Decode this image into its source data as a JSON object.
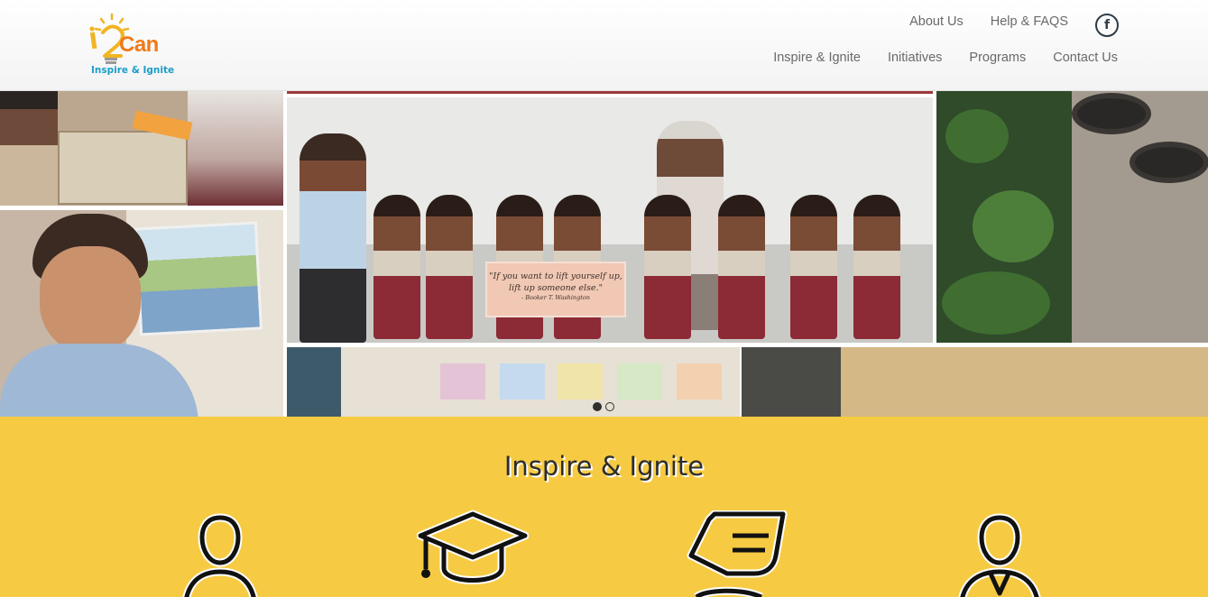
{
  "logo": {
    "brand": "Can",
    "tagline": "Inspire & Ignite",
    "colors": {
      "word": "#ef7a1a",
      "tagline": "#1b9ec9",
      "bulb": "#f2b422"
    }
  },
  "top_nav": {
    "links": [
      {
        "label": "About Us"
      },
      {
        "label": "Help & FAQS"
      }
    ],
    "facebook_icon": "facebook-icon"
  },
  "main_nav": {
    "items": [
      {
        "label": "Inspire & Ignite"
      },
      {
        "label": "Initiatives"
      },
      {
        "label": "Programs"
      },
      {
        "label": "Contact Us"
      }
    ]
  },
  "hero": {
    "quote_line1": "\"If you want to lift yourself up,",
    "quote_line2": "lift up someone else.\"",
    "quote_author": "- Booker T. Washington",
    "slides_total": 2,
    "active_slide": 1
  },
  "section": {
    "title": "Inspire & Ignite",
    "background": "#f6cb43",
    "icons": [
      "student-icon",
      "graduate-icon",
      "helping-hand-icon",
      "mentor-icon"
    ]
  }
}
